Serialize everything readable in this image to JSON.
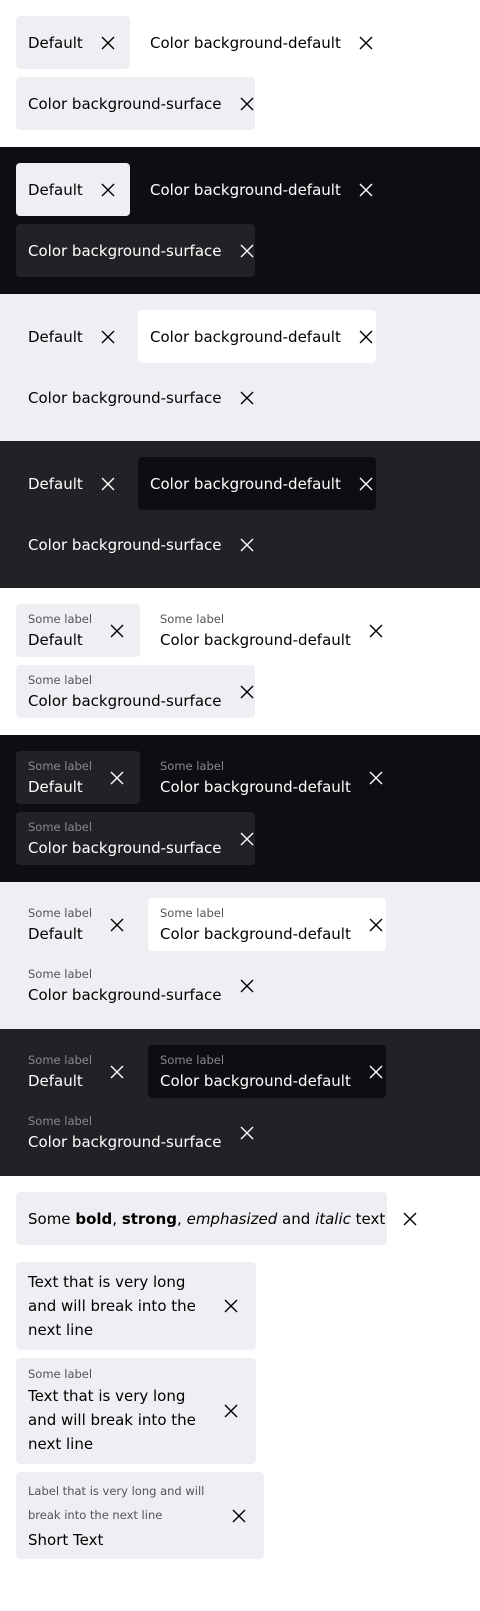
{
  "tags": {
    "default": "Default",
    "bg_default": "Color background-default",
    "bg_surface": "Color background-surface",
    "label": "Some label"
  },
  "rich": {
    "some": "Some",
    "bold": "bold",
    "sep1": ",",
    "strong": "strong",
    "sep2": ",",
    "emphasized": "emphasized",
    "and": "and",
    "italic": "italic",
    "text": "text"
  },
  "long": {
    "text": "Text that is very long and will break into the next line",
    "label": "Some label",
    "long_label": "Label that is very long and will break into the next line",
    "short_text": "Short Text"
  },
  "icons": {
    "dismiss": "close-icon"
  },
  "colors": {
    "dark": "#0e0e12",
    "surface_light": "#eeeff2",
    "surface_dark": "#212225",
    "white": "#ffffff"
  }
}
